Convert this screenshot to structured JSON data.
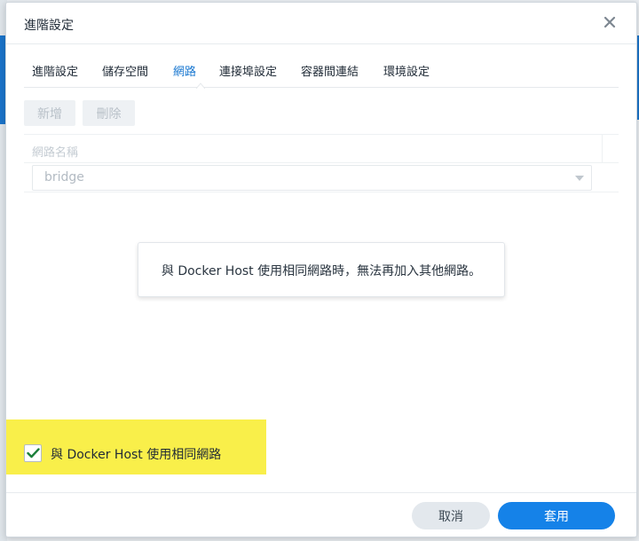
{
  "dialog": {
    "title": "進階設定",
    "close_icon": "close-icon"
  },
  "tabs": [
    {
      "label": "進階設定",
      "active": false
    },
    {
      "label": "儲存空間",
      "active": false
    },
    {
      "label": "網路",
      "active": true
    },
    {
      "label": "連接埠設定",
      "active": false
    },
    {
      "label": "容器間連結",
      "active": false
    },
    {
      "label": "環境設定",
      "active": false
    }
  ],
  "toolbar": {
    "add_label": "新增",
    "delete_label": "刪除"
  },
  "network_table": {
    "column_header": "網路名稱",
    "selected_network": "bridge"
  },
  "message": {
    "text": "與 Docker Host 使用相同網路時，無法再加入其他網路。"
  },
  "host_network_option": {
    "label": "與 Docker Host 使用相同網路",
    "checked": true
  },
  "footer": {
    "cancel_label": "取消",
    "apply_label": "套用"
  },
  "colors": {
    "accent": "#1582e8",
    "active_tab": "#1a78d1",
    "checkmark": "#1b7f3a",
    "highlight": "#f9ef4a"
  }
}
